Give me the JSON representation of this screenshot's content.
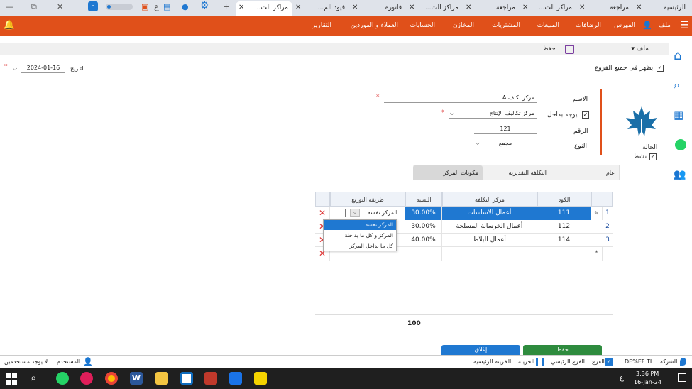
{
  "browser_tabs": [
    {
      "label": "الرئيسية",
      "active": false
    },
    {
      "label": "مراجعة",
      "active": false
    },
    {
      "label": "مراكز الت...",
      "active": false
    },
    {
      "label": "مراجعة",
      "active": false
    },
    {
      "label": "مراكز الت...",
      "active": false
    },
    {
      "label": "فاتورة",
      "active": false
    },
    {
      "label": "قيود الم...",
      "active": false
    },
    {
      "label": "مراكز الت...",
      "active": true
    }
  ],
  "appbar": {
    "menu": [
      "ملف",
      "الفهرس",
      "الرضافات",
      "المبيعات",
      "المشتريات",
      "المخازن",
      "الحسابات",
      "العملاء و الموردين",
      "التقارير"
    ],
    "hamburger": "menu-icon",
    "bell": "bell-icon"
  },
  "toolbar": {
    "file_label": "ملف",
    "save_label": "حفظ"
  },
  "header": {
    "show_all_branches": "يظهر فى جميع الفروع",
    "date_label": "التاريخ",
    "date_value": "2024-01-16"
  },
  "form": {
    "name_label": "الاسم",
    "name_value": "مركز تكلف A",
    "inside_label": "يوجد بداخل",
    "inside_value": "مركز تكاليف الإنتاج",
    "number_label": "الرقم",
    "number_value": "121",
    "type_label": "النوع",
    "type_value": "مجمع",
    "status_label": "الحالة",
    "active_label": "نشط"
  },
  "tabs": [
    "عام",
    "التكلفة التقديرية",
    "مكونات المركز"
  ],
  "grid": {
    "headers": [
      "الكود",
      "مركز التكلفة",
      "النسبة",
      "طريقة التوزيع"
    ],
    "rows": [
      {
        "n": "1",
        "code": "111",
        "center": "أعمال الاساسات",
        "pct": "30.00%",
        "method": "المركز نفسه"
      },
      {
        "n": "2",
        "code": "112",
        "center": "أعمال الخرسانة المسلحة",
        "pct": "30.00%",
        "method": ""
      },
      {
        "n": "3",
        "code": "114",
        "center": "أعمال البلاط",
        "pct": "40.00%",
        "method": ""
      }
    ],
    "new_row_marker": "*",
    "edit_marker": "✎",
    "total": "100"
  },
  "dropdown": {
    "options": [
      "المركز نفسه",
      "المركز و كل ما بداخلة",
      "كل ما بداخل المركز"
    ]
  },
  "buttons": {
    "save": "حفظ",
    "close": "إغلاق"
  },
  "statusbar": {
    "company": "الشركة",
    "company_value": "DE%EF TI",
    "branch": "الفرع",
    "main_branch": "الفرع الرئيسي",
    "treasury": "الخزينة",
    "main_treasury": "الخزينة الرئيسية",
    "user": "المستخدم",
    "no_users": "لا يوجد مستخدمين"
  },
  "taskbar": {
    "time": "3:36 PM",
    "date": "16-Jan-24",
    "lang": "ع"
  },
  "colors": {
    "orange": "#e0501a",
    "blue": "#1f78d1",
    "green": "#2e8b3e"
  }
}
